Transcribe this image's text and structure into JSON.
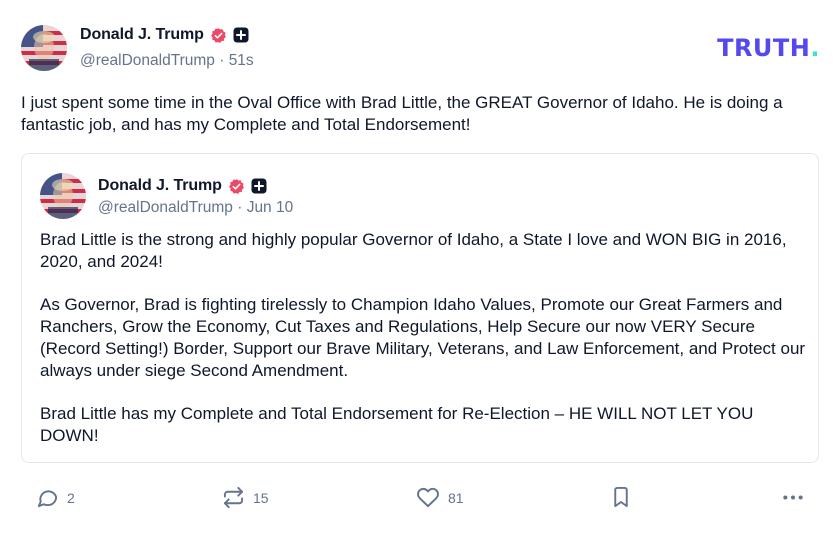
{
  "post": {
    "author": {
      "name": "Donald J. Trump",
      "handle": "@realDonaldTrump",
      "timestamp": "51s"
    },
    "text": "I just spent some time in the Oval Office with Brad Little, the GREAT Governor of Idaho. He is doing a fantastic job, and has my Complete and Total Endorsement!",
    "logo": {
      "main": "TRUTH",
      "dot": "."
    },
    "quote": {
      "author": {
        "name": "Donald J. Trump",
        "handle": "@realDonaldTrump",
        "timestamp": "Jun 10"
      },
      "paragraphs": [
        "Brad Little is the strong and highly popular Governor of Idaho, a State I love and WON BIG in 2016, 2020, and 2024!",
        "As Governor, Brad is fighting tirelessly to Champion Idaho Values, Promote our Great Farmers and Ranchers, Grow the Economy, Cut Taxes and Regulations, Help Secure our now VERY Secure (Record Setting!) Border, Support our Brave Military, Veterans, and Law Enforcement, and Protect our always under siege Second Amendment.",
        "Brad Little has my Complete and Total Endorsement for Re-Election – HE WILL NOT LET YOU DOWN!"
      ]
    },
    "actions": {
      "reply": {
        "icon": "reply-icon",
        "count": "2"
      },
      "repost": {
        "icon": "repost-icon",
        "count": "15"
      },
      "like": {
        "icon": "heart-icon",
        "count": "81"
      },
      "bookmark": {
        "icon": "bookmark-icon"
      },
      "more": {
        "icon": "more-icon"
      }
    }
  },
  "colors": {
    "brand": "#5448ee",
    "brand_accent": "#3ee5c0",
    "verified": "#ec4868",
    "muted": "#64748b",
    "border": "#e2e8f0"
  }
}
